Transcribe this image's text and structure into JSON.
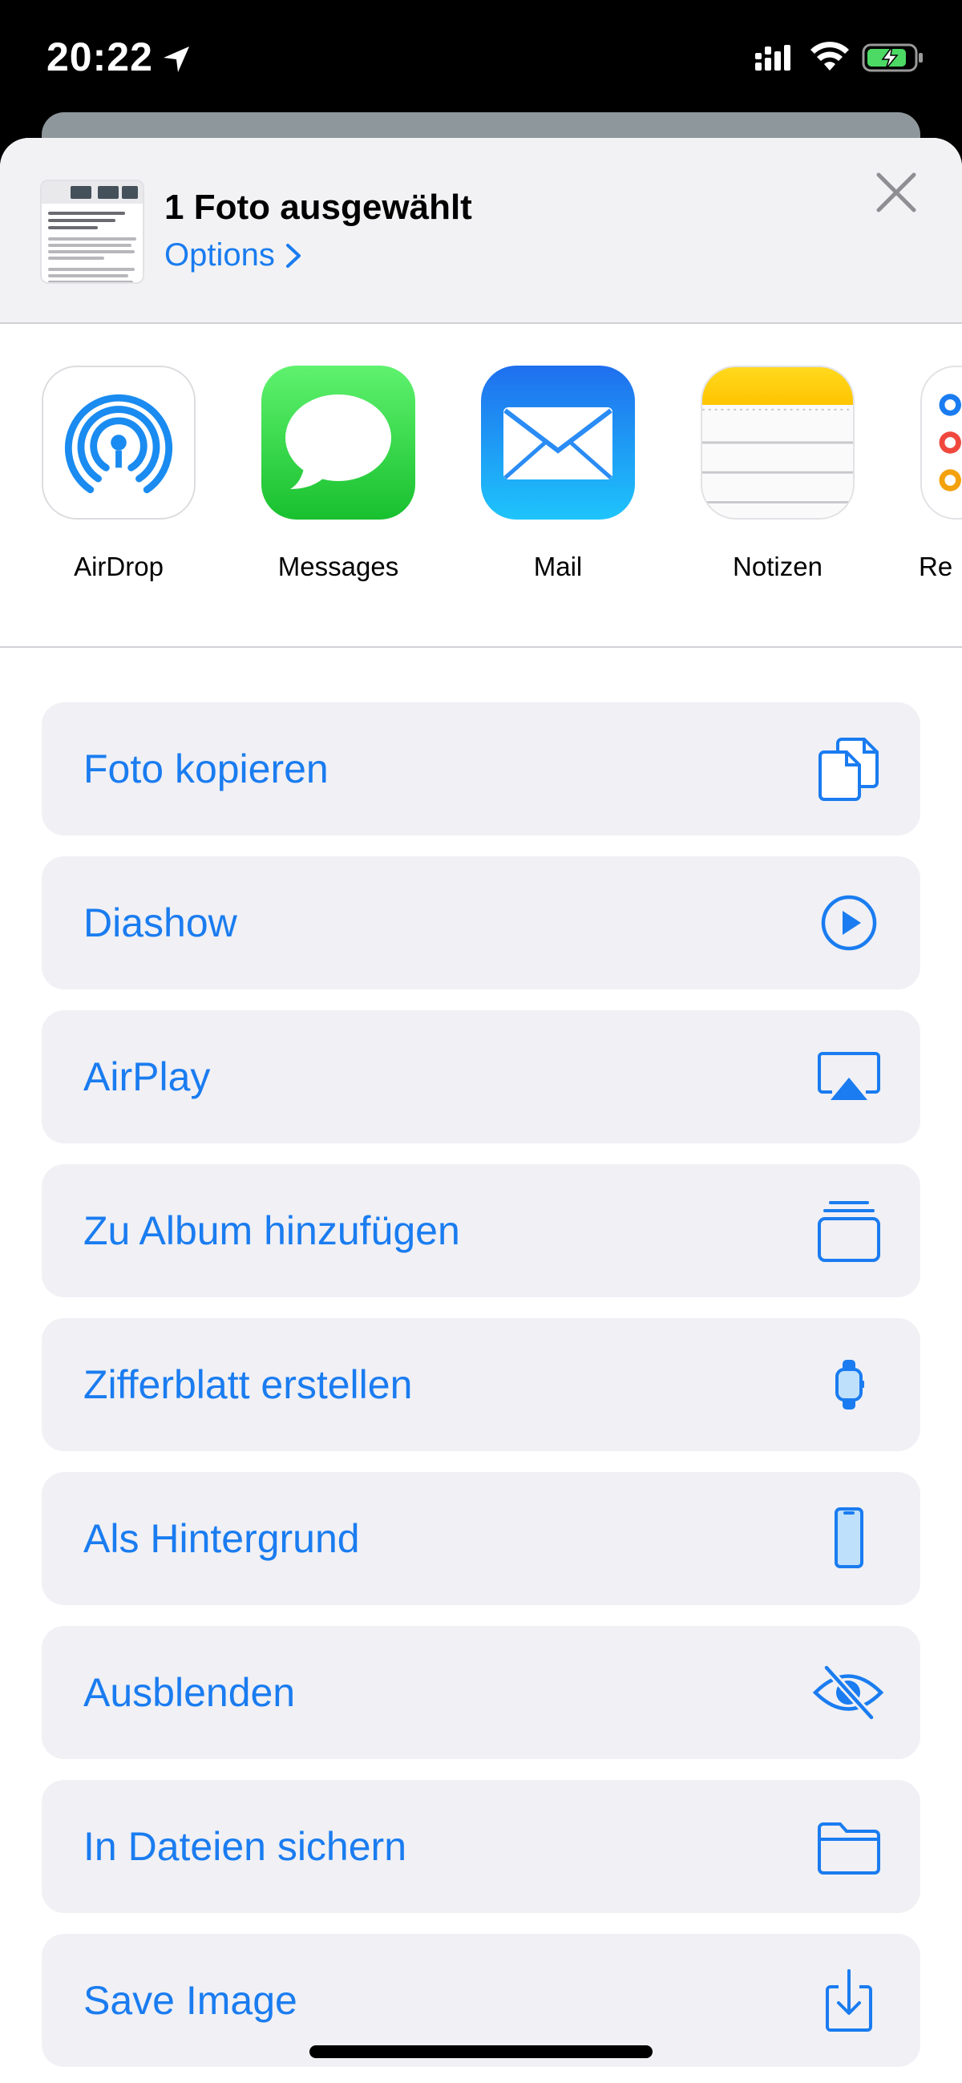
{
  "status_bar": {
    "time": "20:22",
    "icons": [
      "location-arrow-icon",
      "cellular-signal-icon",
      "wifi-icon",
      "battery-charging-icon"
    ]
  },
  "header": {
    "title": "1 Foto ausgewählt",
    "options_label": "Options",
    "close_icon": "close-icon"
  },
  "apps": [
    {
      "label": "AirDrop",
      "icon": "airdrop-icon"
    },
    {
      "label": "Messages",
      "icon": "messages-icon"
    },
    {
      "label": "Mail",
      "icon": "mail-icon"
    },
    {
      "label": "Notizen",
      "icon": "notes-icon"
    },
    {
      "label": "Re",
      "icon": "reminders-icon"
    }
  ],
  "actions": [
    {
      "label": "Foto kopieren",
      "icon": "copy-icon"
    },
    {
      "label": "Diashow",
      "icon": "play-circle-icon"
    },
    {
      "label": "AirPlay",
      "icon": "airplay-icon"
    },
    {
      "label": "Zu Album hinzufügen",
      "icon": "album-stack-icon"
    },
    {
      "label": "Zifferblatt erstellen",
      "icon": "watch-icon"
    },
    {
      "label": "Als Hintergrund",
      "icon": "phone-icon"
    },
    {
      "label": "Ausblenden",
      "icon": "eye-slash-icon"
    },
    {
      "label": "In Dateien sichern",
      "icon": "folder-icon"
    },
    {
      "label": "Save Image",
      "icon": "download-tray-icon"
    }
  ],
  "colors": {
    "accent": "#1a7cf0",
    "action_background": "#f0f0f5",
    "header_background": "#f2f2f4"
  }
}
